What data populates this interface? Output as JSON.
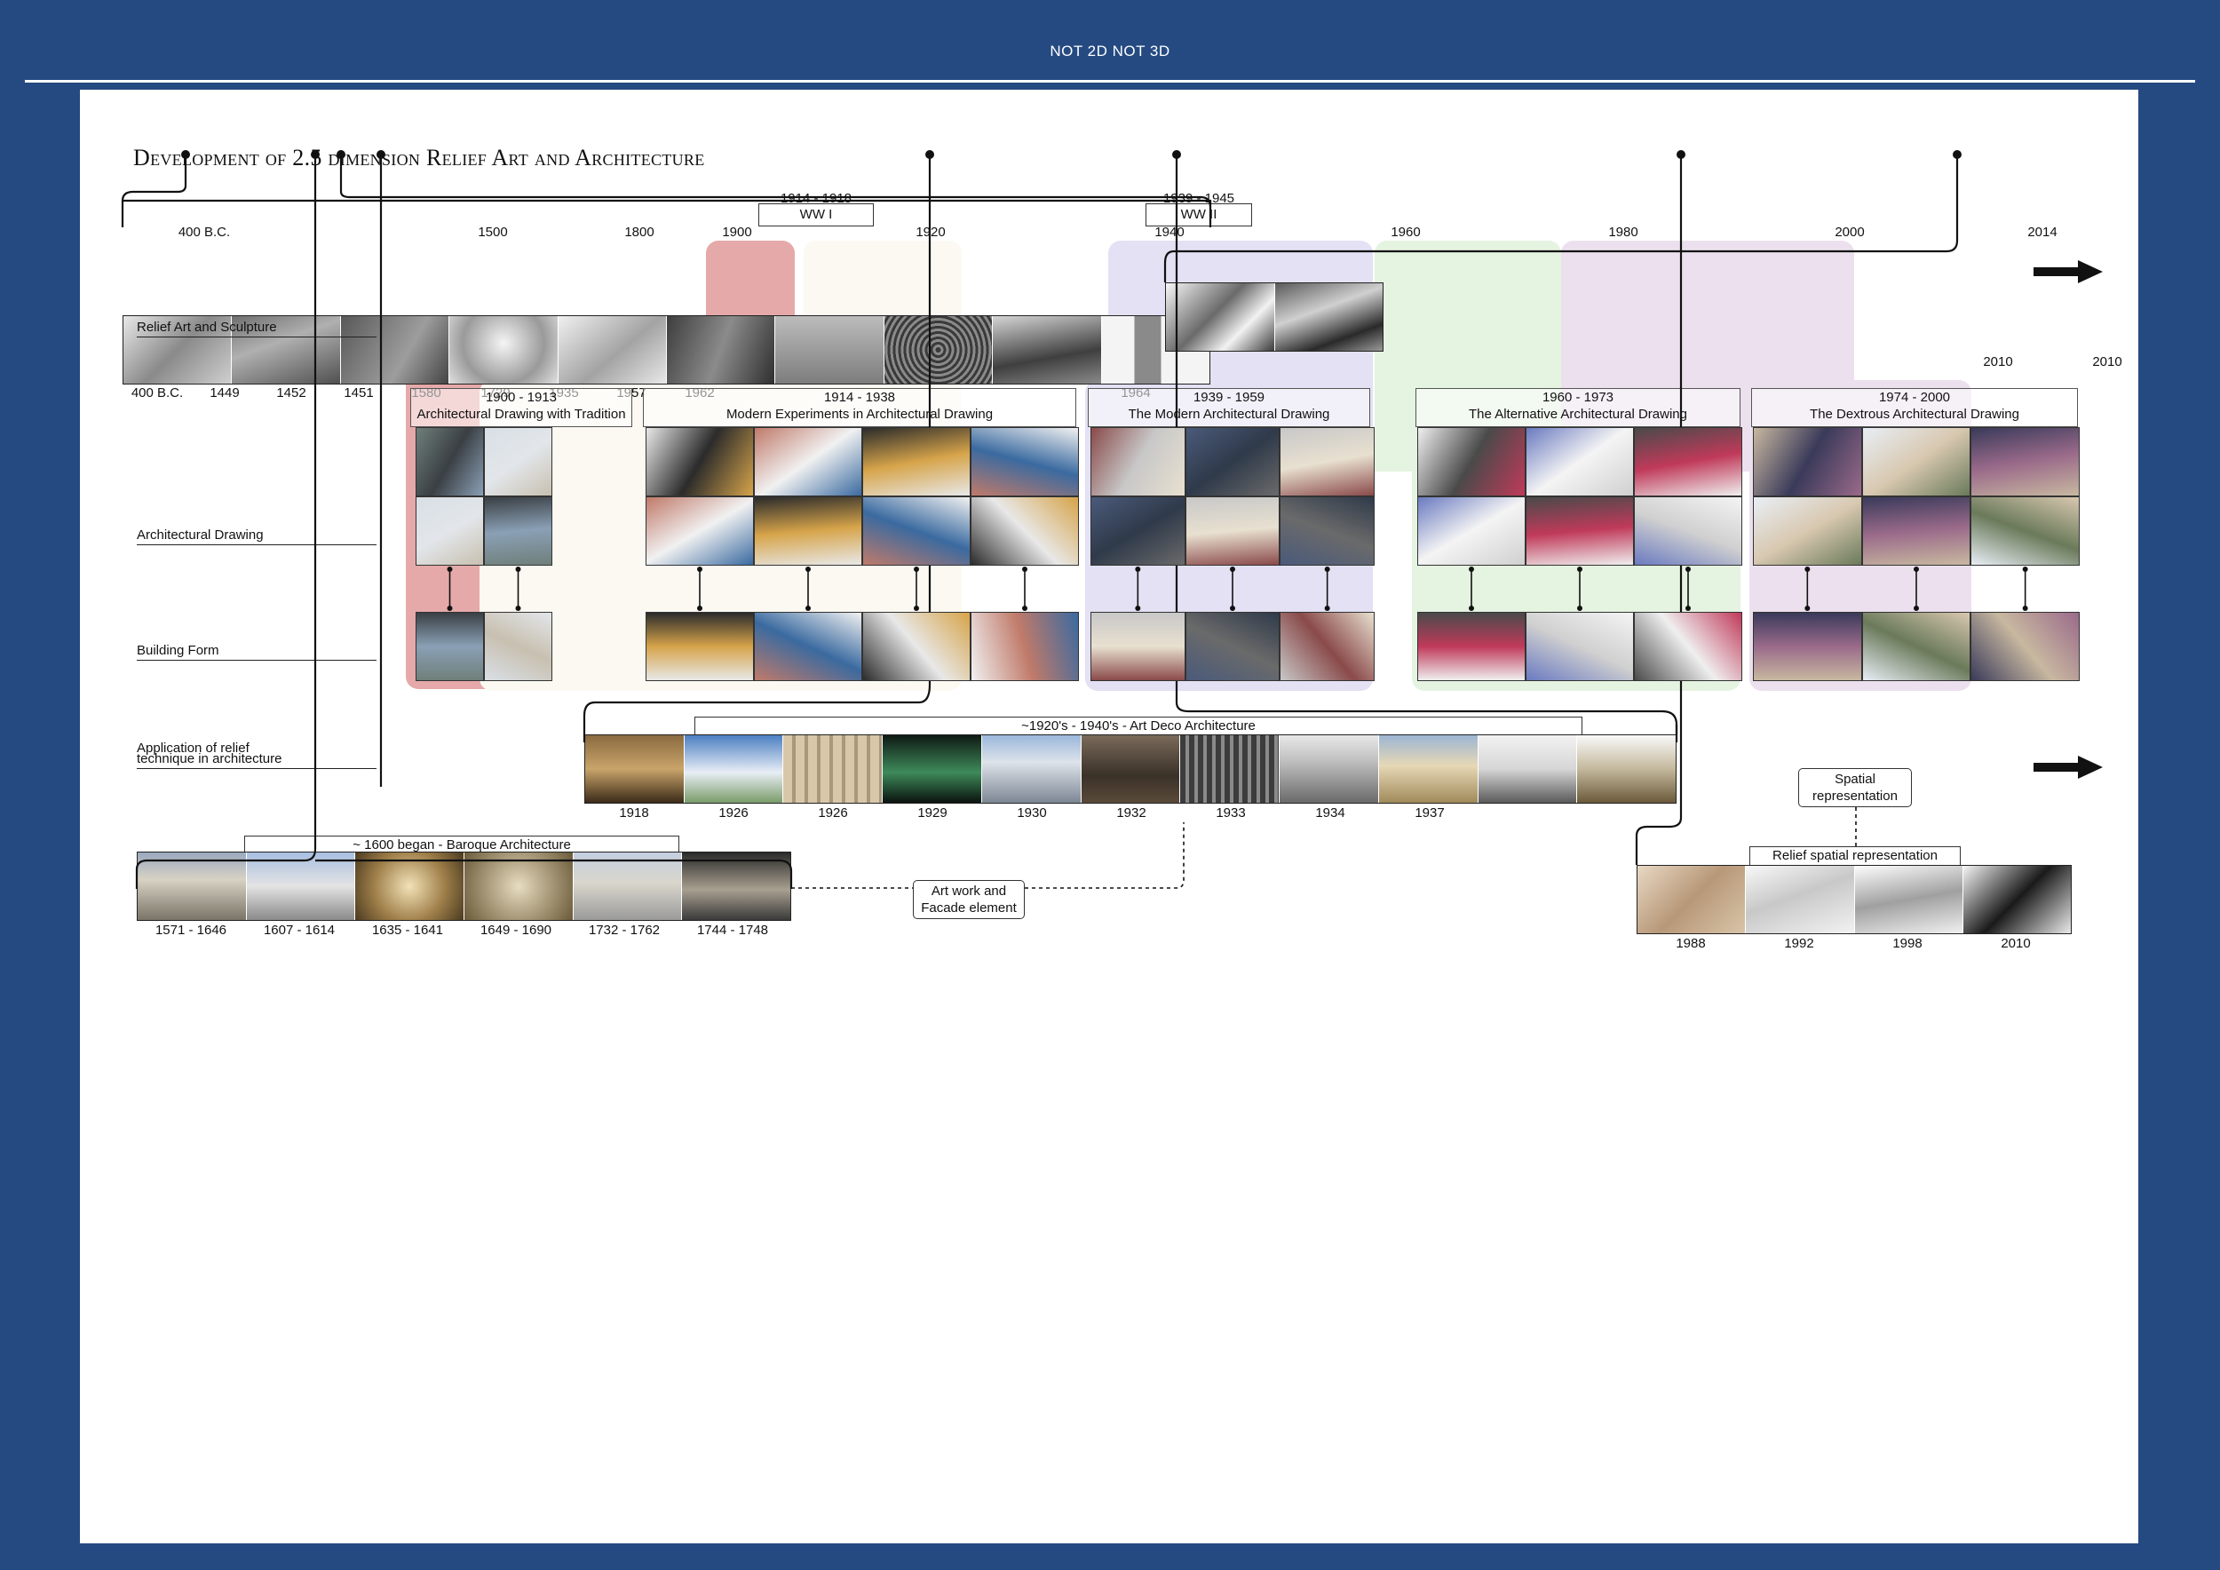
{
  "header": {
    "title": "NOT 2D NOT 3D"
  },
  "panel": {
    "title": "Development of 2.5 dimension Relief Art and Architecture"
  },
  "timeline": {
    "years": [
      "400 B.C.",
      "1500",
      "1800",
      "1900",
      "1920",
      "1940",
      "1960",
      "1980",
      "2000",
      "2014"
    ],
    "wars": [
      {
        "range": "1914 - 1918",
        "label": "WW I"
      },
      {
        "range": "1939 - 1945",
        "label": "WW II"
      }
    ]
  },
  "rows": {
    "relief": "Relief Art and Sculpture",
    "drawing": "Architectural Drawing",
    "building": "Building Form",
    "application_1": "Application of relief",
    "application_2": "technique in architecture"
  },
  "relief_strip": {
    "dates": [
      "400 B.C.",
      "1449",
      "1452",
      "1451",
      "1580",
      "1729",
      "1935",
      "1957",
      "1962",
      "1964"
    ]
  },
  "recent_strip": {
    "dates": [
      "2010",
      "2010"
    ]
  },
  "periods": [
    {
      "range": "1900 - 1913",
      "title": "Architectural Drawing with Tradition"
    },
    {
      "range": "1914 - 1938",
      "title": "Modern Experiments in Architectural Drawing"
    },
    {
      "range": "1939 - 1959",
      "title": "The Modern Architectural Drawing"
    },
    {
      "range": "1960 - 1973",
      "title": "The Alternative Architectural Drawing"
    },
    {
      "range": "1974 - 2000",
      "title": "The Dextrous Architectural Drawing"
    }
  ],
  "artdeco": {
    "label": "~1920's - 1940's - Art Deco Architecture",
    "dates": [
      "1918",
      "1926",
      "1926",
      "1929",
      "1930",
      "1932",
      "1933",
      "1934",
      "1937"
    ]
  },
  "baroque": {
    "label": "~ 1600 began - Baroque Architecture",
    "dates": [
      "1571 - 1646",
      "1607 - 1614",
      "1635 - 1641",
      "1649 - 1690",
      "1732 - 1762",
      "1744 - 1748"
    ]
  },
  "spatial": {
    "label": "Relief spatial representation",
    "dates": [
      "1988",
      "1992",
      "1998",
      "2010"
    ]
  },
  "callouts": {
    "artwork_1": "Art work and",
    "artwork_2": "Facade element",
    "spatial_1": "Spatial",
    "spatial_2": "representation"
  }
}
